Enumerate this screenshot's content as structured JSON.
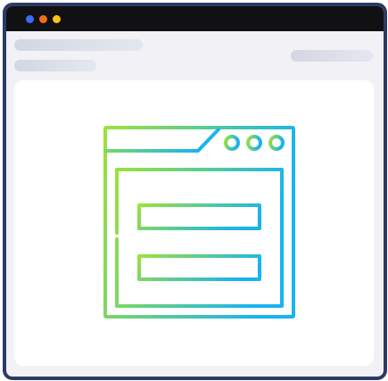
{
  "window": {
    "controls": [
      {
        "name": "close-dot",
        "color": "#3b6cf6"
      },
      {
        "name": "minimize-dot",
        "color": "#f26b1d"
      },
      {
        "name": "maximize-dot",
        "color": "#f7c21a"
      }
    ],
    "frame_color": "#2c3a64",
    "titlebar_color": "#111114",
    "background_color": "#f1f1f6"
  },
  "header": {
    "placeholders": [
      "title-skeleton",
      "subtitle-skeleton",
      "action-skeleton"
    ]
  },
  "illustration": {
    "icon": "browser-form-icon",
    "gradient_start": "#9be23a",
    "gradient_end": "#18b4f0",
    "form_fields": 2
  }
}
